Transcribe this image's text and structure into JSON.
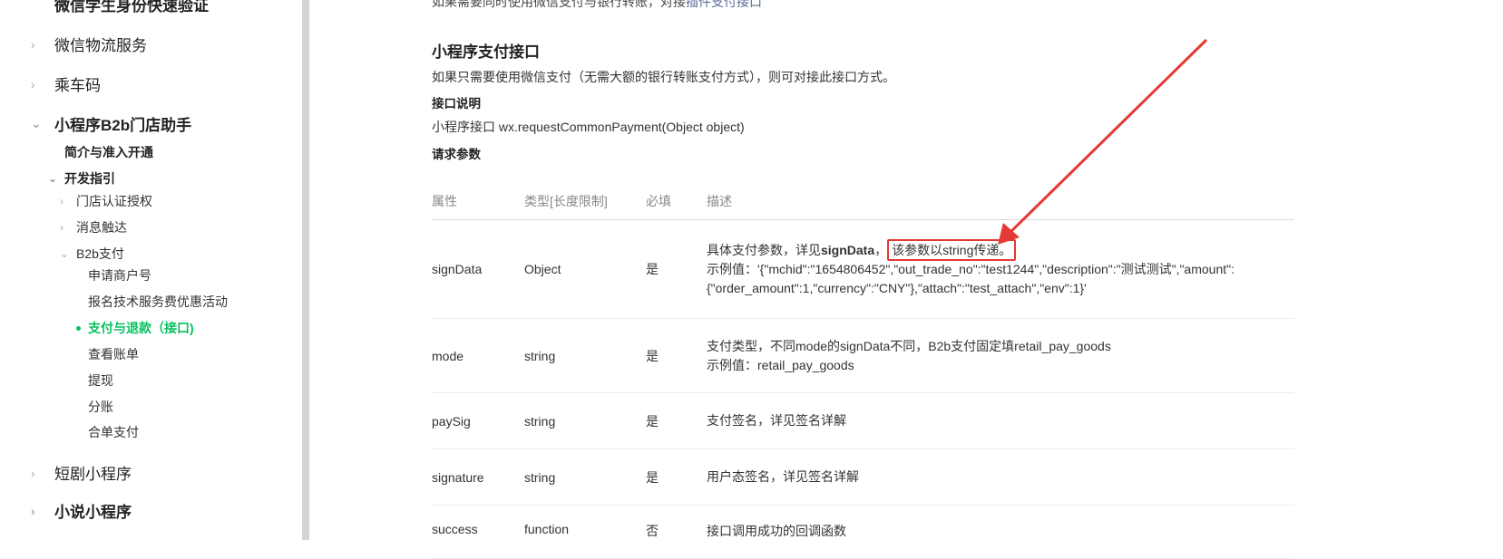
{
  "sidebar": {
    "l1_items": [
      {
        "label": "微信学生身份快速验证"
      },
      {
        "label": "微信物流服务"
      },
      {
        "label": "乘车码"
      },
      {
        "label": "小程序B2b门店助手"
      },
      {
        "label": "短剧小程序"
      },
      {
        "label": "小说小程序"
      }
    ],
    "intro_label": "简介与准入开通",
    "dev_guide_label": "开发指引",
    "store_auth_label": "门店认证授权",
    "message_label": "消息触达",
    "b2b_pay_label": "B2b支付",
    "b2b_children": [
      {
        "label": "申请商户号"
      },
      {
        "label": "报名技术服务费优惠活动"
      },
      {
        "label": "支付与退款（接口)"
      },
      {
        "label": "查看账单"
      },
      {
        "label": "提现"
      },
      {
        "label": "分账"
      },
      {
        "label": "合单支付"
      }
    ]
  },
  "main": {
    "top_partial_text": "如果需要同时使用微信支付与银行转账，对接",
    "top_partial_link": "插件支付接口",
    "section_title": "小程序支付接口",
    "intro": "如果只需要使用微信支付（无需大额的银行转账支付方式），则可对接此接口方式。",
    "api_desc_heading": "接口说明",
    "api_desc_text": "小程序接口 wx.requestCommonPayment(Object object)",
    "params_heading": "请求参数",
    "table": {
      "headers": [
        "属性",
        "类型[长度限制]",
        "必填",
        "描述"
      ],
      "signData": {
        "name": "signData",
        "type": "Object",
        "required": "是",
        "desc_prefix": "具体支付参数，详见",
        "desc_bold": "signData",
        "desc_comma": "，",
        "desc_highlight": "该参数以string传递。",
        "example_line1": "示例值：'{\"mchid\":\"1654806452\",\"out_trade_no\":\"test1244\",\"description\":\"测试测试\",\"amount\":",
        "example_line2": "{\"order_amount\":1,\"currency\":\"CNY\"},\"attach\":\"test_attach\",\"env\":1}'"
      },
      "mode": {
        "name": "mode",
        "type": "string",
        "required": "是",
        "desc_line1": "支付类型，不同mode的signData不同，B2b支付固定填retail_pay_goods",
        "desc_line2": "示例值：retail_pay_goods"
      },
      "paySig": {
        "name": "paySig",
        "type": "string",
        "required": "是",
        "desc": "支付签名，详见签名详解"
      },
      "signature": {
        "name": "signature",
        "type": "string",
        "required": "是",
        "desc": "用户态签名，详见签名详解"
      },
      "success": {
        "name": "success",
        "type": "function",
        "required": "否",
        "desc": "接口调用成功的回调函数"
      }
    }
  },
  "annotation": {
    "arrow_color": "#e53935"
  }
}
